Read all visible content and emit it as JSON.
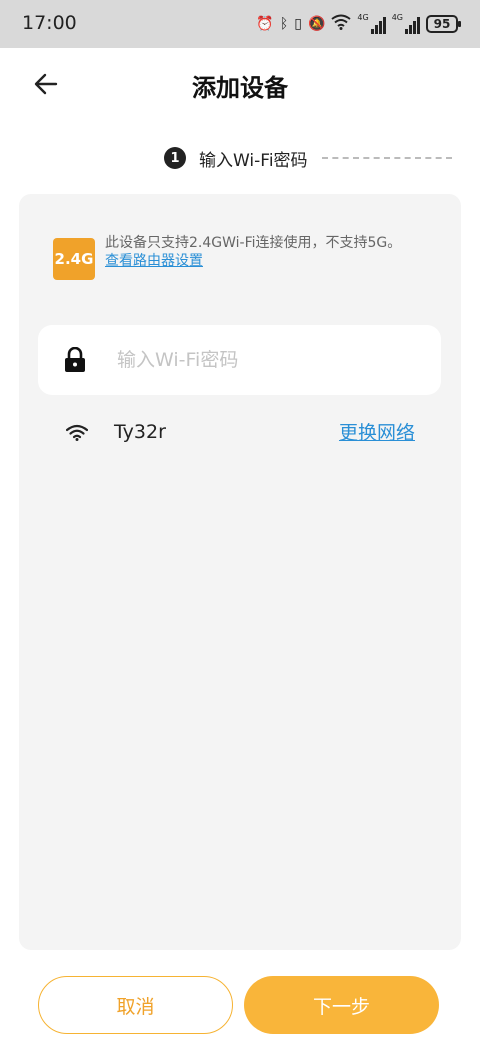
{
  "status_bar": {
    "time": "17:00",
    "network1_label": "4G",
    "network2_label": "4G",
    "battery": "95"
  },
  "header": {
    "title": "添加设备"
  },
  "step": {
    "number": "1",
    "label": "输入Wi-Fi密码"
  },
  "notice": {
    "badge": "2.4G",
    "text": "此设备只支持2.4GWi-Fi连接使用，不支持5G。",
    "link": "查看路由器设置"
  },
  "password": {
    "value": "",
    "placeholder": "输入Wi-Fi密码"
  },
  "network": {
    "ssid": "Ty32r",
    "change_label": "更换网络"
  },
  "footer": {
    "cancel_label": "取消",
    "next_label": "下一步"
  },
  "colors": {
    "accent": "#f9b53a",
    "link": "#2a8fd6",
    "card_bg": "#f4f4f4"
  }
}
